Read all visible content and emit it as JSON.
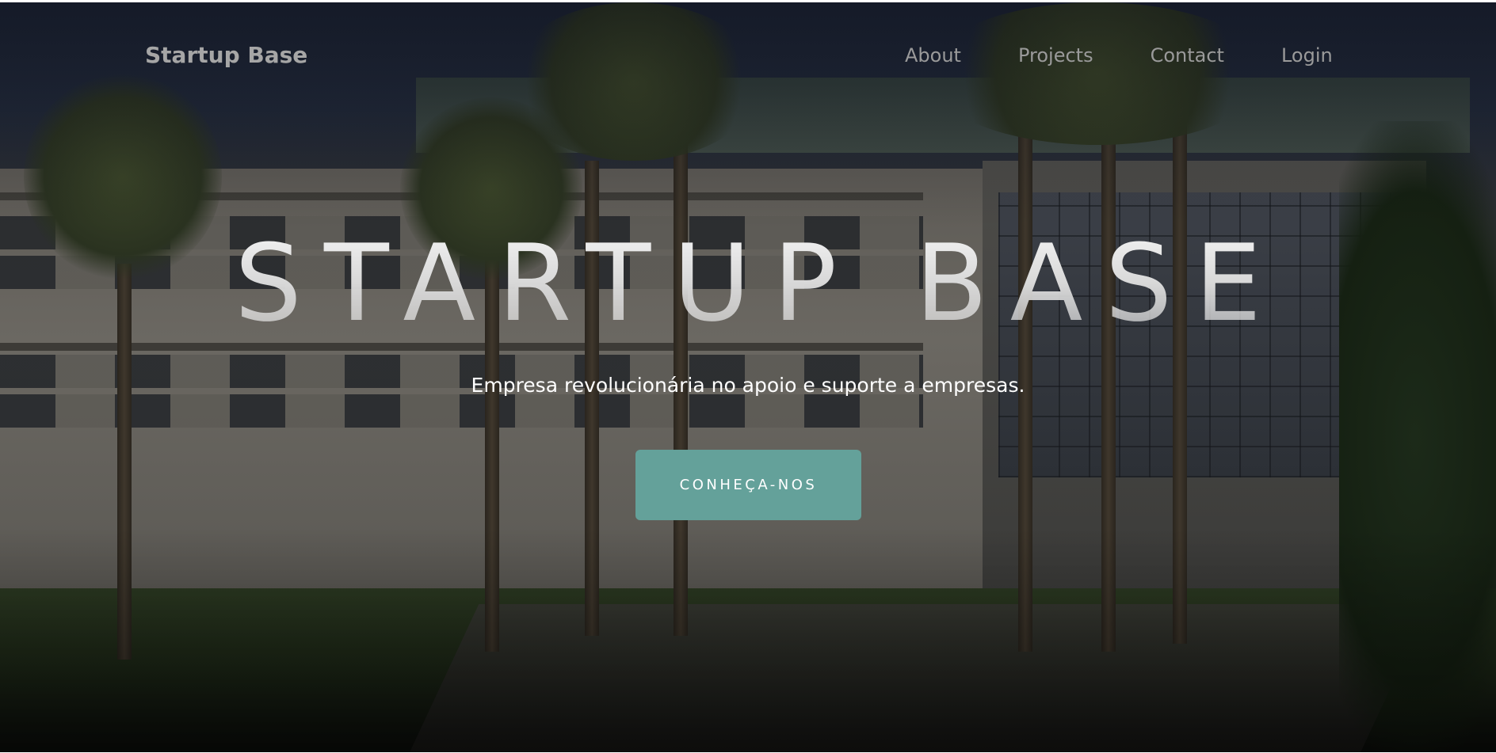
{
  "navbar": {
    "brand": "Startup Base",
    "links": [
      "About",
      "Projects",
      "Contact",
      "Login"
    ]
  },
  "hero": {
    "title": "STARTUP BASE",
    "subtitle": "Empresa revolucionária no apoio e suporte a empresas.",
    "cta_label": "CONHEÇA-NOS"
  },
  "colors": {
    "accent": "#64a19a",
    "nav_text": "#9a9a9a",
    "hero_text": "#ffffff"
  }
}
